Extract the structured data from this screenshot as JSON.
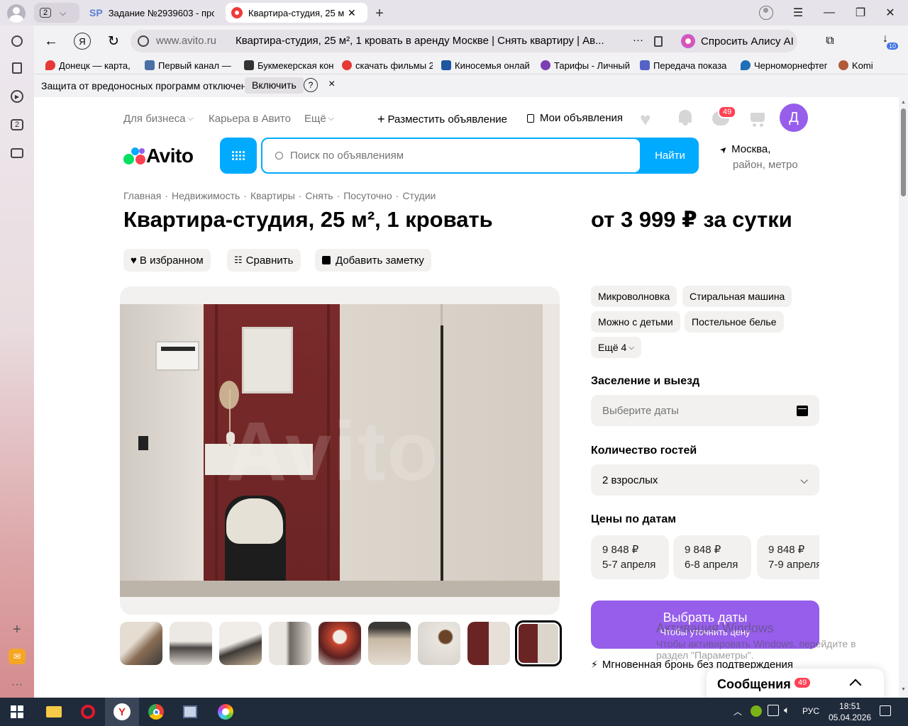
{
  "browser": {
    "tab_count": "2",
    "tabs": [
      {
        "label": "Задание №2939603 - про",
        "favicon": "SP"
      },
      {
        "label": "Квартира-студия, 25 м"
      }
    ],
    "address": {
      "domain": "www.avito.ru",
      "title": "Квартира-студия, 25 м², 1 кровать в аренду Москве | Снять квартиру | Ав...",
      "more": "···"
    },
    "alice_label": "Спросить Алису AI",
    "downloads_badge": "10",
    "bookmarks": [
      {
        "label": "Донецк — карта, ",
        "color": "#e53935"
      },
      {
        "label": "Первый канал — с",
        "color": "#4a6fa5"
      },
      {
        "label": "Букмекерская кон",
        "color": "#333333"
      },
      {
        "label": "скачать фильмы 2",
        "color": "#e53935"
      },
      {
        "label": "Киносемья онлай",
        "color": "#1e56a0"
      },
      {
        "label": "Тарифы - Личный",
        "color": "#7b3fb5"
      },
      {
        "label": "Передача показа",
        "color": "#5563c8"
      },
      {
        "label": "Черноморнефтег",
        "color": "#1e6fb8"
      },
      {
        "label": "Komi",
        "color": "#b05a3a"
      }
    ],
    "infobar": {
      "text": "Защита от вредоносных программ отключена",
      "button": "Включить",
      "help": "?",
      "close": "×"
    }
  },
  "avito": {
    "topnav": {
      "business": "Для бизнеса",
      "career": "Карьера в Авито",
      "more": "Ещё",
      "post": "Разместить объявление",
      "my_ads": "Мои объявления",
      "messages_badge": "49",
      "avatar": "Д"
    },
    "logo": "Avito",
    "search": {
      "placeholder": "Поиск по объявлениям",
      "button": "Найти"
    },
    "location": {
      "line1": "Москва,",
      "line2": "район, метро"
    },
    "breadcrumbs": [
      "Главная",
      "Недвижимость",
      "Квартиры",
      "Снять",
      "Посуточно",
      "Студии"
    ],
    "title": "Квартира-студия, 25 м², 1 кровать",
    "price": "от 3 999 ₽ за сутки",
    "actions": {
      "favorite": "В избранном",
      "compare": "Сравнить",
      "note": "Добавить заметку"
    },
    "watermark": "Avito",
    "amenities": [
      "Микроволновка",
      "Стиральная машина",
      "Можно с детьми",
      "Постельное белье"
    ],
    "amenities_more": "Ещё 4",
    "checkin": {
      "heading": "Заселение и выезд",
      "placeholder": "Выберите даты"
    },
    "guests": {
      "heading": "Количество гостей",
      "value": "2 взрослых"
    },
    "prices": {
      "heading": "Цены по датам",
      "items": [
        {
          "price": "9 848 ₽",
          "dates": "5-7 апреля"
        },
        {
          "price": "9 848 ₽",
          "dates": "6-8 апреля"
        },
        {
          "price": "9 848 ₽",
          "dates": "7-9 апреля"
        }
      ]
    },
    "cta": {
      "label": "Выбрать даты",
      "sub": "Чтобы уточнить цену"
    },
    "instant": "Мгновенная бронь без подтверждения",
    "messenger": {
      "label": "Сообщения",
      "badge": "49"
    }
  },
  "windows_activation": {
    "title": "Активация Windows",
    "line1": "Чтобы активировать Windows, перейдите в",
    "line2": "раздел \"Параметры\"."
  },
  "taskbar": {
    "lang": "РУС",
    "time": "18:51",
    "date": "05.04.2026"
  },
  "colors": {
    "avito_blue": "#00aaff",
    "avito_purple": "#965eeb",
    "accent_red": "#ff4053"
  }
}
